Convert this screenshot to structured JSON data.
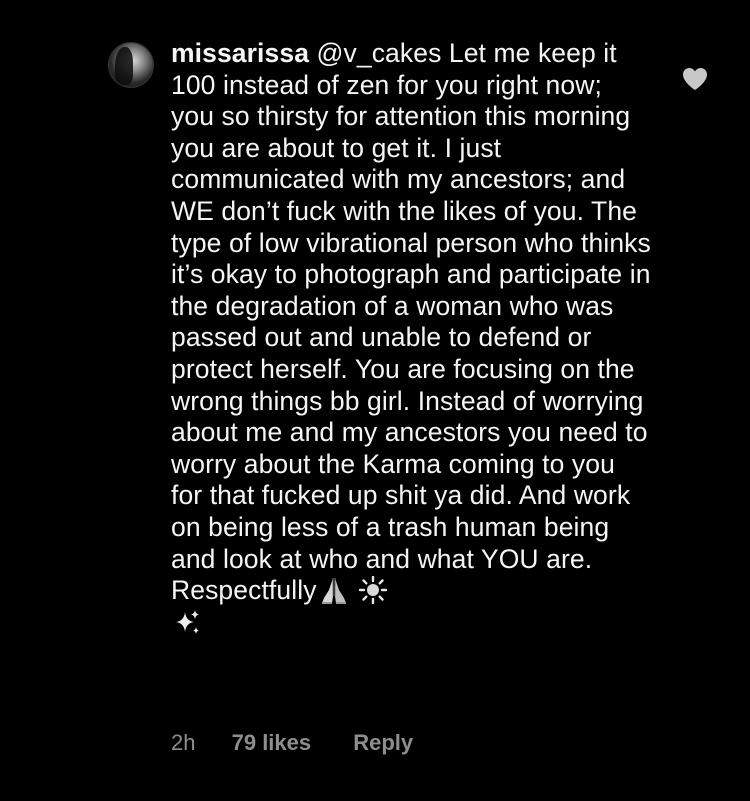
{
  "comment": {
    "username": "missarissa",
    "text": "@v_cakes Let me keep it 100 instead of zen for you right now; you so thirsty for attention this morning you are about to get it. I just communicated with my ancestors; and WE don’t fuck with the likes of you. The type of low vibrational person who thinks it’s okay to photograph and participate in the degradation of a woman who was passed out and unable to defend or protect herself. You are focusing on the wrong things bb girl. Instead of worrying about me and my ancestors you need to worry about the Karma coming to you for that fucked up shit ya did. And work on being less of a trash human being and look at who and what YOU are. Respectfully",
    "emojis": [
      "folded-hands",
      "sun",
      "sparkles"
    ],
    "time": "2h",
    "likes": "79 likes",
    "reply_label": "Reply"
  },
  "icons": {
    "like": "heart-icon"
  },
  "colors": {
    "background": "#000000",
    "text": "#f5f5f5",
    "meta": "#8e8e8e",
    "heart": "#c7c7c7"
  }
}
